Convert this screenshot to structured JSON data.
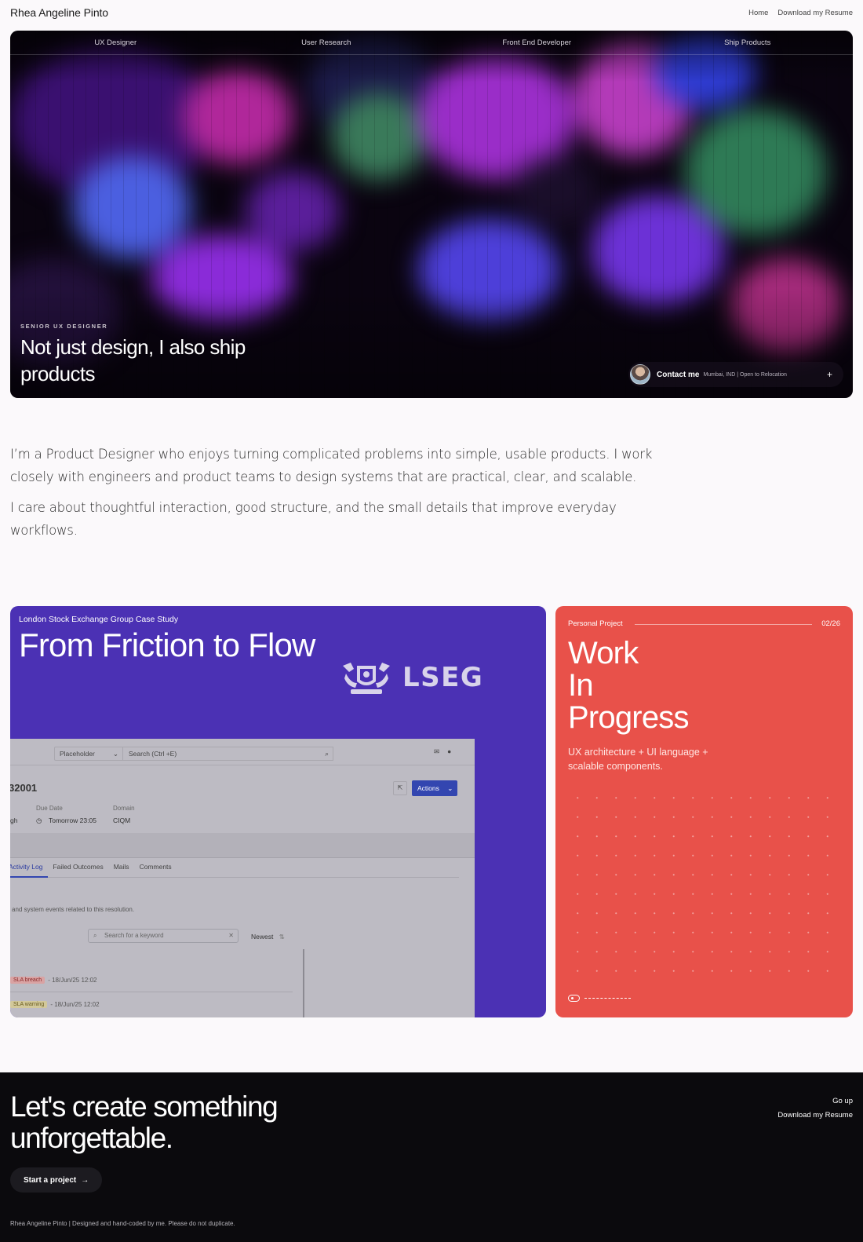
{
  "header": {
    "brand": "Rhea Angeline Pinto",
    "nav": [
      "Home",
      "Download my Resume"
    ]
  },
  "hero": {
    "tabs": [
      "UX Designer",
      "User Research",
      "Front End Developer",
      "Ship Products"
    ],
    "eyebrow": "SENIOR UX DESIGNER",
    "title": "Not just design, I also ship products",
    "contact": {
      "label": "Contact me",
      "meta": "Mumbai, IND | Open to Relocation",
      "plus": "+"
    }
  },
  "intro": {
    "p1": "I’m a Product Designer who enjoys turning complicated problems into simple, usable products. I work closely with engineers and product teams to design systems that are practical, clear, and scalable.",
    "p2": "I care about thoughtful interaction, good structure, and the small details that improve everyday workflows."
  },
  "case_study": {
    "eyebrow": "London Stock Exchange Group Case Study",
    "title": "From Friction to Flow",
    "logo_text": "LSEG",
    "mockup": {
      "select": "Placeholder",
      "search": "Search (Ctrl +E)",
      "record_id": "32001",
      "actions": "Actions",
      "labels": {
        "due_date": "Due Date",
        "domain": "Domain"
      },
      "values": {
        "left": "gh",
        "due_date": "Tomorrow 23:05",
        "domain": "CIQM"
      },
      "tabs": [
        "Activity Log",
        "Failed Outcomes",
        "Mails",
        "Comments"
      ],
      "desc": "and system events related to this resolution.",
      "keyword_placeholder": "Search for a keyword",
      "sort": "Newest",
      "rows": [
        {
          "badge": "SLA breach",
          "time": "- 18/Jun/25 12:02"
        },
        {
          "badge": "SLA warning",
          "time": "- 18/Jun/25 12:02"
        }
      ]
    }
  },
  "wip": {
    "eyebrow": "Personal Project",
    "count": "02/26",
    "title_lines": [
      "Work",
      "In",
      "Progress"
    ],
    "desc": "UX architecture + UI language + scalable components."
  },
  "footer": {
    "title": "Let's create something unforgettable.",
    "links": [
      "Go up",
      "Download my Resume"
    ],
    "cta": "Start a project",
    "cta_arrow": "→",
    "copy": "Rhea Angeline Pinto | Designed and hand-coded by me. Please do not duplicate."
  },
  "colors": {
    "page_bg": "#fbf9fb",
    "case_study_bg": "#4b31b4",
    "wip_bg": "#e8514a",
    "footer_bg": "#0b0a0d",
    "actions_button": "#3346b0"
  }
}
